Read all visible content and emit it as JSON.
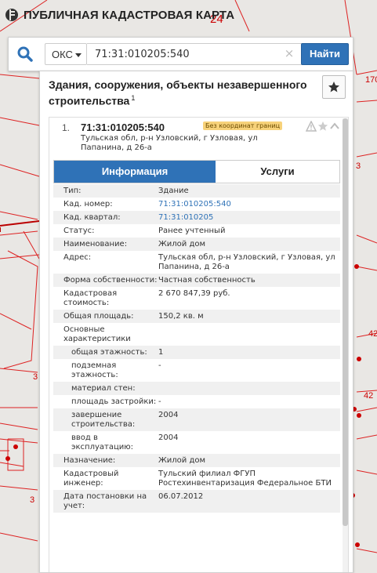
{
  "app": {
    "title": "ПУБЛИЧНАЯ КАДАСТРОВАЯ КАРТА"
  },
  "map": {
    "labels": [
      "24",
      "170",
      "3",
      "42",
      "42",
      "3",
      "3"
    ]
  },
  "search": {
    "type_label": "ОКС",
    "query": "71:31:010205:540",
    "clear_glyph": "×",
    "find_label": "Найти"
  },
  "panel": {
    "title": "Здания, сооружения, объекты незавершенного строительства",
    "title_sup": "1"
  },
  "card": {
    "number": "1.",
    "title": "71:31:010205:540",
    "badge": "Без координат границ",
    "address": "Тульская обл, р-н Узловский, г Узловая, ул Папанина, д 26-а"
  },
  "tabs": {
    "info": "Информация",
    "services": "Услуги"
  },
  "rows": [
    {
      "k": "Тип:",
      "v": "Здание"
    },
    {
      "k": "Кад. номер:",
      "v": "71:31:010205:540",
      "link": true
    },
    {
      "k": "Кад. квартал:",
      "v": "71:31:010205",
      "link": true
    },
    {
      "k": "Статус:",
      "v": "Ранее учтенный"
    },
    {
      "k": "Наименование:",
      "v": "Жилой дом"
    },
    {
      "k": "Адрес:",
      "v": "Тульская обл, р-н Узловский, г Узловая, ул Папанина, д 26-а"
    },
    {
      "k": "Форма собственности:",
      "v": "Частная собственность"
    },
    {
      "k": "Кадастровая стоимость:",
      "v": "2 670 847,39 руб."
    },
    {
      "k": "Общая площадь:",
      "v": "150,2 кв. м"
    },
    {
      "k": "Основные характеристики",
      "v": ""
    },
    {
      "k": "общая этажность:",
      "v": "1",
      "sub": true
    },
    {
      "k": "подземная этажность:",
      "v": "-",
      "sub": true
    },
    {
      "k": "материал стен:",
      "v": "",
      "sub": true
    },
    {
      "k": "площадь застройки:",
      "v": "-",
      "sub": true
    },
    {
      "k": "завершение строительства:",
      "v": "2004",
      "sub": true
    },
    {
      "k": "ввод в эксплуатацию:",
      "v": "2004",
      "sub": true
    },
    {
      "k": "Назначение:",
      "v": "Жилой дом"
    },
    {
      "k": "Кадастровый инженер:",
      "v": "Тульский филиал ФГУП Ростехинвентаризация Федеральное БТИ"
    },
    {
      "k": "Дата постановки на учет:",
      "v": "06.07.2012"
    }
  ]
}
